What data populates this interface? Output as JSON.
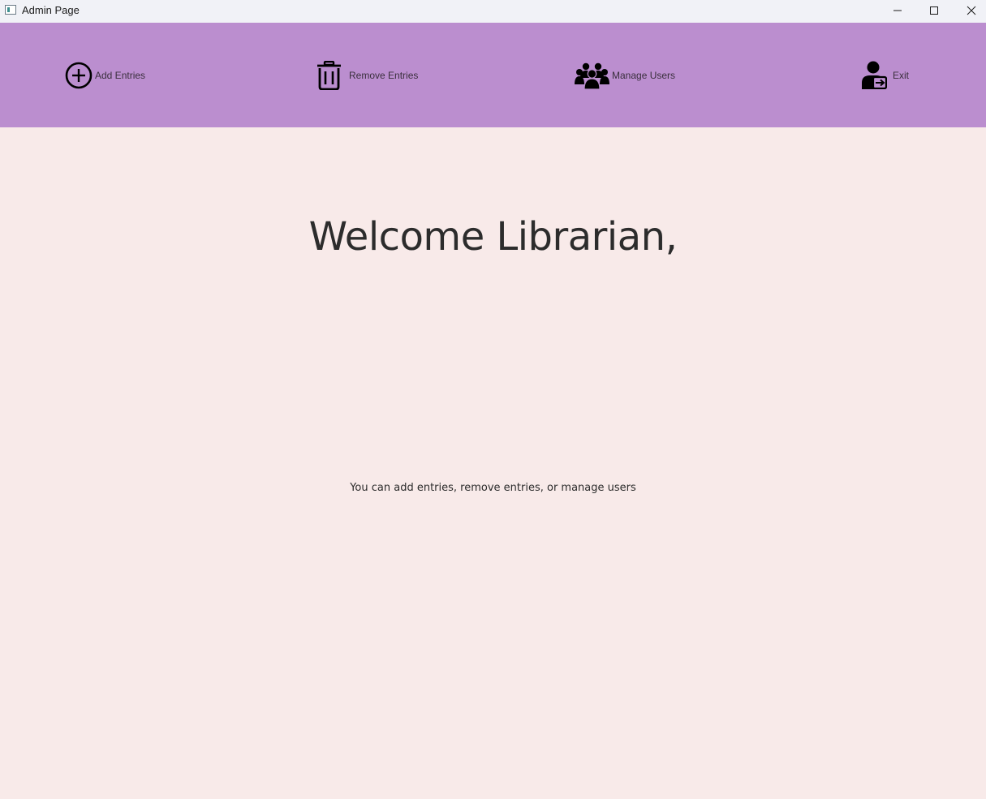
{
  "window": {
    "title": "Admin Page"
  },
  "toolbar": {
    "background": "#bb8ecf",
    "items": [
      {
        "label": "Add Entries",
        "icon": "plus-circle-icon"
      },
      {
        "label": "Remove Entries",
        "icon": "trash-icon"
      },
      {
        "label": "Manage Users",
        "icon": "users-group-icon"
      },
      {
        "label": "Exit",
        "icon": "user-exit-icon"
      }
    ]
  },
  "main": {
    "background": "#f8eae9",
    "heading": "Welcome Librarian,",
    "subtitle": "You can add entries, remove entries, or manage users"
  }
}
